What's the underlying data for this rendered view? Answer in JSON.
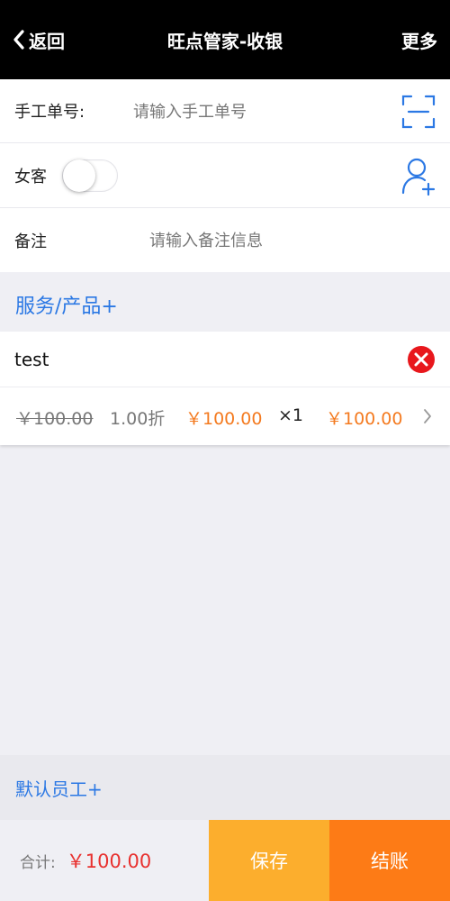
{
  "header": {
    "back_label": "返回",
    "title": "旺点管家-收银",
    "more_label": "更多"
  },
  "form": {
    "order_no_label": "手工单号:",
    "order_no_placeholder": "请输入手工单号",
    "order_no_value": "",
    "female_label": "女客",
    "female_enabled": false,
    "remark_label": "备注",
    "remark_placeholder": "请输入备注信息",
    "remark_value": ""
  },
  "service_link": "服务/产品+",
  "items": [
    {
      "name": "test",
      "original_price": "￥100.00",
      "discount": "1.00折",
      "unit_price": "￥100.00",
      "quantity": "×1",
      "subtotal": "￥100.00"
    }
  ],
  "staff_link": "默认员工+",
  "footer": {
    "total_label": "合计:",
    "total_value": "￥100.00",
    "save_label": "保存",
    "checkout_label": "结账"
  },
  "colors": {
    "link_blue": "#2b78e4",
    "price_orange": "#f47a1f",
    "total_red": "#e8312f",
    "save_yellow": "#fcae2d",
    "checkout_orange": "#fd7b16",
    "remove_red": "#e8171c"
  },
  "icons": {
    "back": "chevron-left-icon",
    "scan": "scan-icon",
    "add_user": "add-user-icon",
    "remove": "close-circle-icon",
    "detail": "chevron-right-icon"
  }
}
